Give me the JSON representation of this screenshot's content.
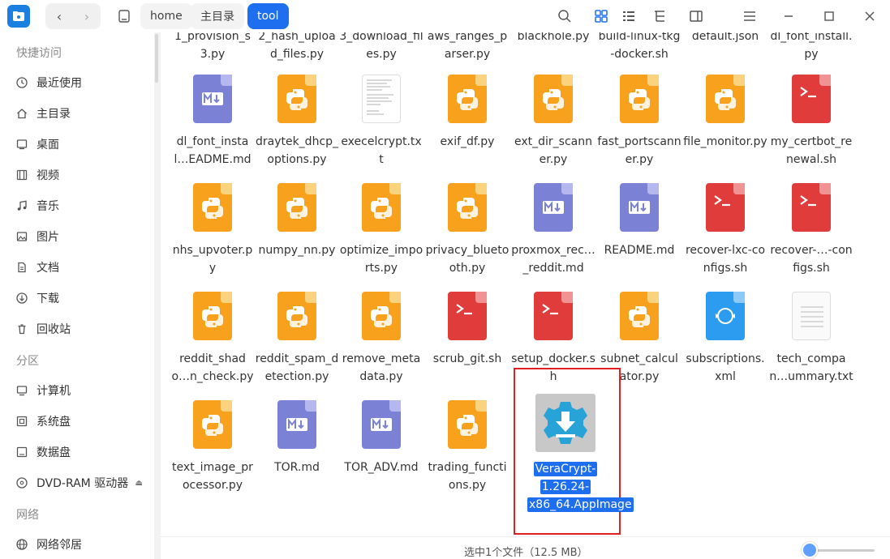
{
  "breadcrumbs": [
    "home",
    "主目录",
    "tool"
  ],
  "sidebar": {
    "groups": [
      "快捷访问",
      "分区",
      "网络"
    ],
    "quick": [
      "最近使用",
      "主目录",
      "桌面",
      "视频",
      "音乐",
      "图片",
      "文档",
      "下载",
      "回收站"
    ],
    "partitions": [
      "计算机",
      "系统盘",
      "数据盘",
      "DVD-RAM 驱动器"
    ],
    "network": [
      "网络邻居"
    ]
  },
  "files": [
    {
      "name": "1_provision_s3.py",
      "type": "py"
    },
    {
      "name": "2_hash_upload_files.py",
      "type": "py"
    },
    {
      "name": "3_download_files.py",
      "type": "py"
    },
    {
      "name": "aws_ranges_parser.py",
      "type": "py"
    },
    {
      "name": "blackhole.py",
      "type": "py"
    },
    {
      "name": "build-linux-tkg-docker.sh",
      "type": "sh"
    },
    {
      "name": "default.json",
      "type": "doc"
    },
    {
      "name": "dl_font_install.py",
      "type": "py"
    },
    {
      "name": "dl_font_instal…EADME.md",
      "type": "md"
    },
    {
      "name": "draytek_dhcp_options.py",
      "type": "py"
    },
    {
      "name": "execelcrypt.txt",
      "type": "txt"
    },
    {
      "name": "exif_df.py",
      "type": "py"
    },
    {
      "name": "ext_dir_scanner.py",
      "type": "py"
    },
    {
      "name": "fast_portscanner.py",
      "type": "py"
    },
    {
      "name": "file_monitor.py",
      "type": "py"
    },
    {
      "name": "my_certbot_renewal.sh",
      "type": "sh"
    },
    {
      "name": "nhs_upvoter.py",
      "type": "py"
    },
    {
      "name": "numpy_nn.py",
      "type": "py"
    },
    {
      "name": "optimize_imports.py",
      "type": "py"
    },
    {
      "name": "privacy_bluetooth.py",
      "type": "py"
    },
    {
      "name": "proxmox_rec…_reddit.md",
      "type": "md"
    },
    {
      "name": "README.md",
      "type": "md"
    },
    {
      "name": "recover-lxc-configs.sh",
      "type": "sh"
    },
    {
      "name": "recover-…-configs.sh",
      "type": "sh"
    },
    {
      "name": "reddit_shado…n_check.py",
      "type": "py"
    },
    {
      "name": "reddit_spam_detection.py",
      "type": "py"
    },
    {
      "name": "remove_metadata.py",
      "type": "py"
    },
    {
      "name": "scrub_git.sh",
      "type": "sh"
    },
    {
      "name": "setup_docker.sh",
      "type": "sh"
    },
    {
      "name": "subnet_calculator.py",
      "type": "py"
    },
    {
      "name": "subscriptions.xml",
      "type": "xml"
    },
    {
      "name": "tech_compan…ummary.txt",
      "type": "doc"
    },
    {
      "name": "text_image_processor.py",
      "type": "py"
    },
    {
      "name": "TOR.md",
      "type": "md"
    },
    {
      "name": "TOR_ADV.md",
      "type": "md"
    },
    {
      "name": "trading_functions.py",
      "type": "py"
    },
    {
      "name": "VeraCrypt-1.26.24-x86_64.AppImage",
      "type": "appimage",
      "selected": true
    }
  ],
  "status": "选中1个文件（12.5 MB）",
  "colors": {
    "accent": "#1e6ef0",
    "python": "#f7a11c",
    "markdown": "#7b82d6",
    "shell": "#e03c3c",
    "xml": "#2b9cf0"
  }
}
